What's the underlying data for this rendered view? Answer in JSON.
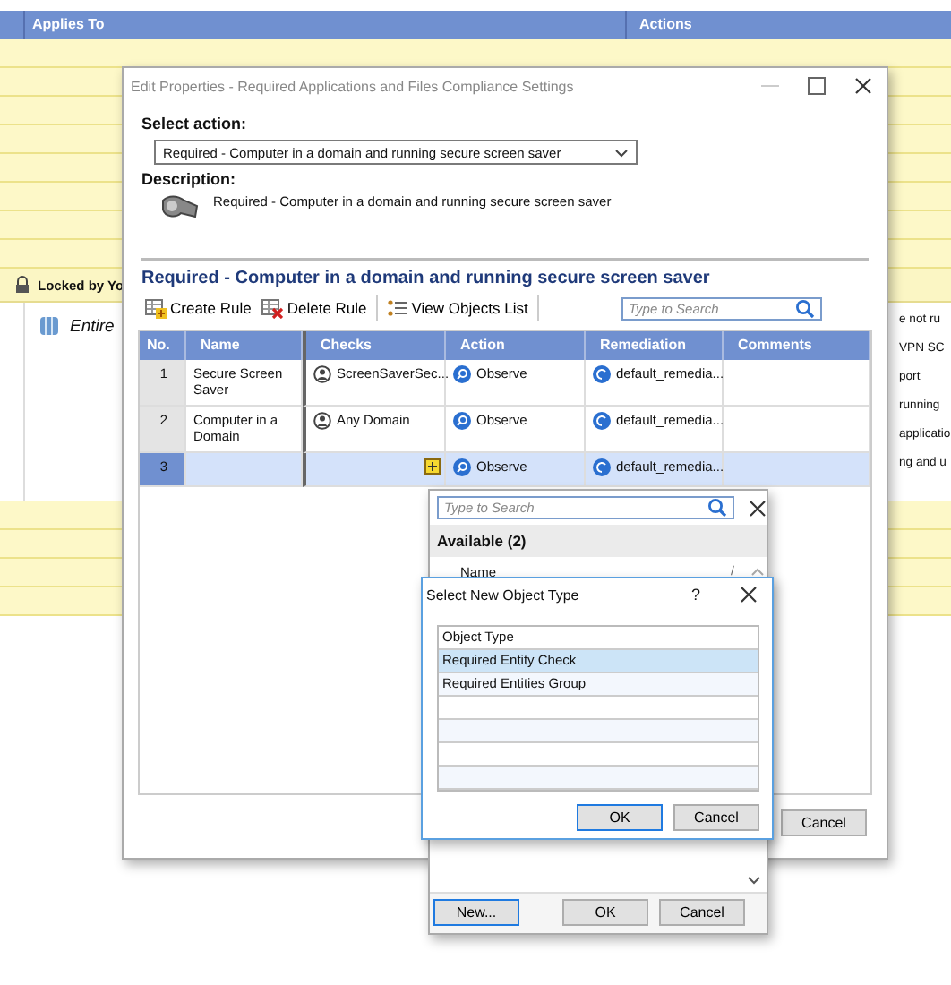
{
  "background": {
    "columns": [
      "Applies To",
      "Actions"
    ],
    "locked_label": "Locked by Yo",
    "row_label": "Entire",
    "right_texts": [
      "e not ru",
      "VPN SC",
      "port",
      "running",
      "applicatio",
      "ng and u"
    ]
  },
  "dialog": {
    "title": "Edit Properties - Required Applications and Files Compliance Settings",
    "select_action_label": "Select action:",
    "action_value": "Required - Computer in a domain and running secure screen saver",
    "description_label": "Description:",
    "description": "Required - Computer in a domain and running secure screen saver",
    "heading": "Required - Computer in a domain and running secure screen saver",
    "toolbar": [
      {
        "label": "Create Rule",
        "kind": "create"
      },
      {
        "label": "Delete Rule",
        "kind": "delete"
      },
      {
        "label": "View Objects List",
        "kind": "list"
      }
    ],
    "search": {
      "placeholder": "Type to Search"
    },
    "table": {
      "columns": [
        "No.",
        "Name",
        "Checks",
        "Action",
        "Remediation",
        "Comments"
      ],
      "rows": [
        {
          "no": "1",
          "name": "Secure Screen Saver",
          "check": "ScreenSaverSec...",
          "kind": "entity",
          "action": "Observe",
          "remediation": "default_remedia...",
          "selected": false
        },
        {
          "no": "2",
          "name": "Computer in a Domain",
          "check": "Any Domain",
          "kind": "entity",
          "action": "Observe",
          "remediation": "default_remedia...",
          "selected": false
        },
        {
          "no": "3",
          "kind": "add",
          "action": "Observe",
          "remediation": "default_remedia...",
          "selected": true
        }
      ]
    },
    "buttons": [
      {
        "label": "Cancel",
        "default": false
      }
    ]
  },
  "picker": {
    "search": {
      "placeholder": "Type to Search"
    },
    "group": "Available (2)",
    "column": "Name",
    "sort_mark": "/",
    "buttons": [
      {
        "label": "New...",
        "default": true
      },
      {
        "label": "OK",
        "default": false
      },
      {
        "label": "Cancel",
        "default": false
      }
    ]
  },
  "type_dialog": {
    "title": "Select New Object Type",
    "help": "?",
    "column": "Object Type",
    "items": [
      {
        "label": "Required Entity Check",
        "selected": true
      },
      {
        "label": "Required Entities Group",
        "selected": false
      }
    ],
    "buttons": [
      {
        "label": "OK",
        "default": true
      },
      {
        "label": "Cancel",
        "default": false
      }
    ]
  }
}
